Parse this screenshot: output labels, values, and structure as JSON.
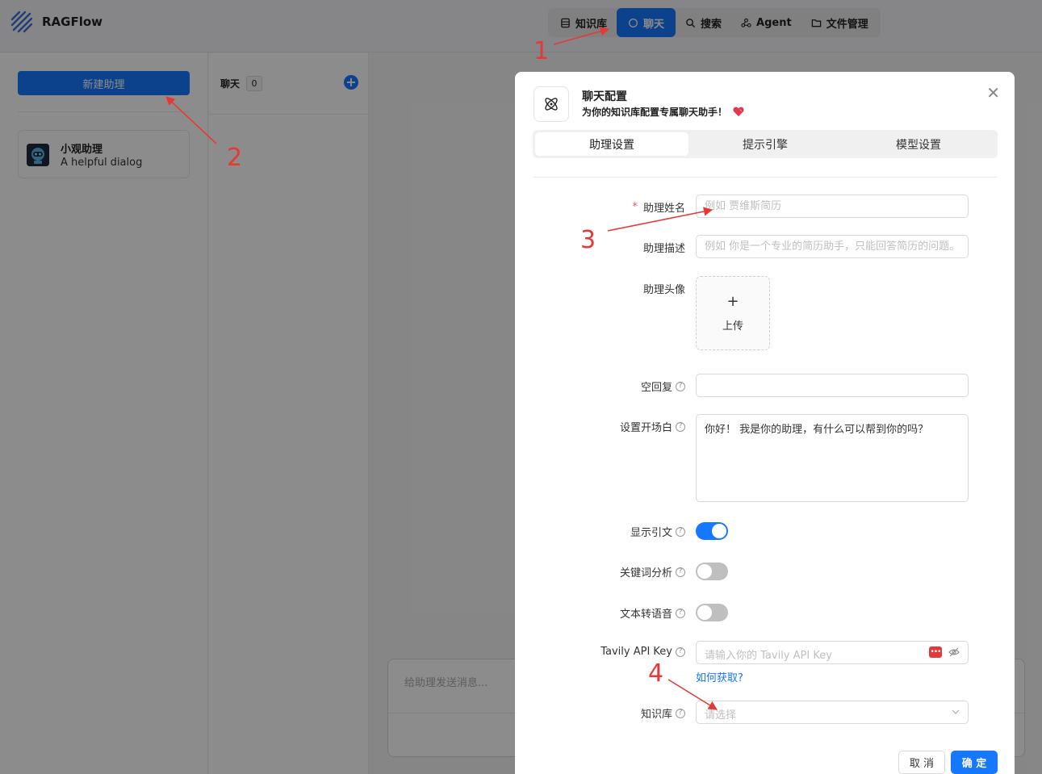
{
  "app": {
    "name": "RAGFlow"
  },
  "nav": {
    "items": [
      {
        "label": "知识库",
        "icon": "database-icon"
      },
      {
        "label": "聊天",
        "icon": "chat-icon",
        "active": true
      },
      {
        "label": "搜索",
        "icon": "search-icon"
      },
      {
        "label": "Agent",
        "icon": "agent-icon"
      },
      {
        "label": "文件管理",
        "icon": "folder-icon"
      }
    ]
  },
  "sidebar": {
    "new_button": "新建助理",
    "assistants": [
      {
        "name": "小观助理",
        "description": "A helpful dialog"
      }
    ]
  },
  "chatlist": {
    "title": "聊天",
    "count": "0"
  },
  "chat_input": {
    "placeholder": "给助理发送消息..."
  },
  "modal": {
    "title": "聊天配置",
    "subtitle": "为你的知识库配置专属聊天助手！",
    "tabs": [
      {
        "label": "助理设置",
        "active": true
      },
      {
        "label": "提示引擎"
      },
      {
        "label": "模型设置"
      }
    ],
    "fields": {
      "name": {
        "label": "助理姓名",
        "required": true,
        "placeholder": "例如 贾维斯简历",
        "value": ""
      },
      "description": {
        "label": "助理描述",
        "placeholder": "例如 你是一个专业的简历助手，只能回答简历的问题。",
        "value": ""
      },
      "avatar": {
        "label": "助理头像",
        "upload_label": "上传"
      },
      "empty_response": {
        "label": "空回复",
        "value": ""
      },
      "opener": {
        "label": "设置开场白",
        "value": "你好！ 我是你的助理，有什么可以帮到你的吗？"
      },
      "show_quote": {
        "label": "显示引文",
        "on": true
      },
      "keyword": {
        "label": "关键词分析",
        "on": false
      },
      "tts": {
        "label": "文本转语音",
        "on": false
      },
      "tavily": {
        "label": "Tavily API Key",
        "placeholder": "请输入你的 Tavily API Key",
        "link": "如何获取?"
      },
      "kb": {
        "label": "知识库",
        "placeholder": "请选择"
      }
    },
    "cancel": "取 消",
    "ok": "确 定"
  },
  "annotations": [
    "1",
    "2",
    "3",
    "4"
  ],
  "colors": {
    "accent": "#1677ff",
    "annotation": "#e53935"
  }
}
